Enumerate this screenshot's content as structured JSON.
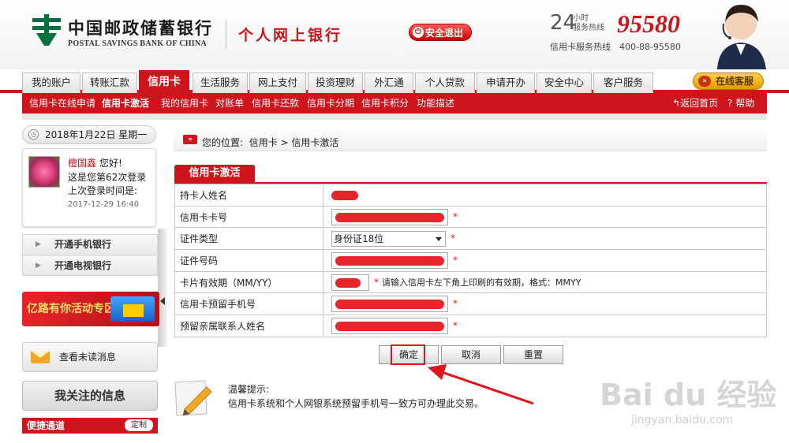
{
  "header": {
    "bank_name_cn": "中国邮政储蓄银行",
    "bank_name_en": "POSTAL SAVINGS BANK OF CHINA",
    "ebank": "个人网上银行",
    "logout": "安全退出",
    "hotline_24": "24",
    "hotline_hours": "小时",
    "hotline_label": "服务热线",
    "hotline_number": "95580",
    "cc_hotline": "信用卡服务热线　400-88-95580"
  },
  "nav": {
    "tabs": [
      "我的账户",
      "转账汇款",
      "信用卡",
      "生活服务",
      "网上支付",
      "投资理财",
      "外汇通",
      "个人贷款",
      "申请开办",
      "安全中心",
      "客户服务"
    ],
    "active": "信用卡",
    "online_service": "在线客服"
  },
  "subnav": {
    "items": [
      "信用卡在线申请",
      "信用卡激活",
      "我的信用卡",
      "对账单",
      "信用卡还款",
      "信用卡分期",
      "信用卡积分",
      "功能描述"
    ],
    "active": "信用卡激活",
    "home": "返回首页",
    "help": "帮助"
  },
  "left": {
    "date": "2018年1月22日 星期一",
    "user_name": "檀国鑫",
    "hello": "您好!",
    "login_count": "这是您第62次登录",
    "last_login_label": "上次登录时间是:",
    "last_login_time": "2017-12-29 16:40",
    "items": [
      "开通手机银行",
      "开通电视银行"
    ],
    "promo": "亿路有你活动专区",
    "unread": "查看未读消息",
    "follow": "我关注的信息",
    "quick": "便捷通道",
    "custom": "定制"
  },
  "breadcrumb": {
    "label": "您的位置:",
    "path": "信用卡 > 信用卡激活"
  },
  "form": {
    "title": "信用卡激活",
    "rows": {
      "holder": "持卡人姓名",
      "card_no": "信用卡卡号",
      "id_type": "证件类型",
      "id_no": "证件号码",
      "expiry": "卡片有效期（MM/YY）",
      "phone": "信用卡预留手机号",
      "relative": "预留亲属联系人姓名"
    },
    "id_type_value": "身份证18位",
    "expiry_hint": "请输入信用卡左下角上印刷的有效期，格式：MMYY",
    "required": "*"
  },
  "buttons": {
    "confirm": "确定",
    "cancel": "取消",
    "reset": "重置"
  },
  "tips": {
    "title": "温馨提示:",
    "text": "信用卡系统和个人网银系统预留手机号一致方可办理此交易。"
  },
  "watermark": {
    "logo": "Bai du 经验",
    "url": "jingyan.baidu.com"
  },
  "colors": {
    "brand_red": "#d0141b",
    "logo_green": "#00703c",
    "gold": "#e39a00"
  }
}
